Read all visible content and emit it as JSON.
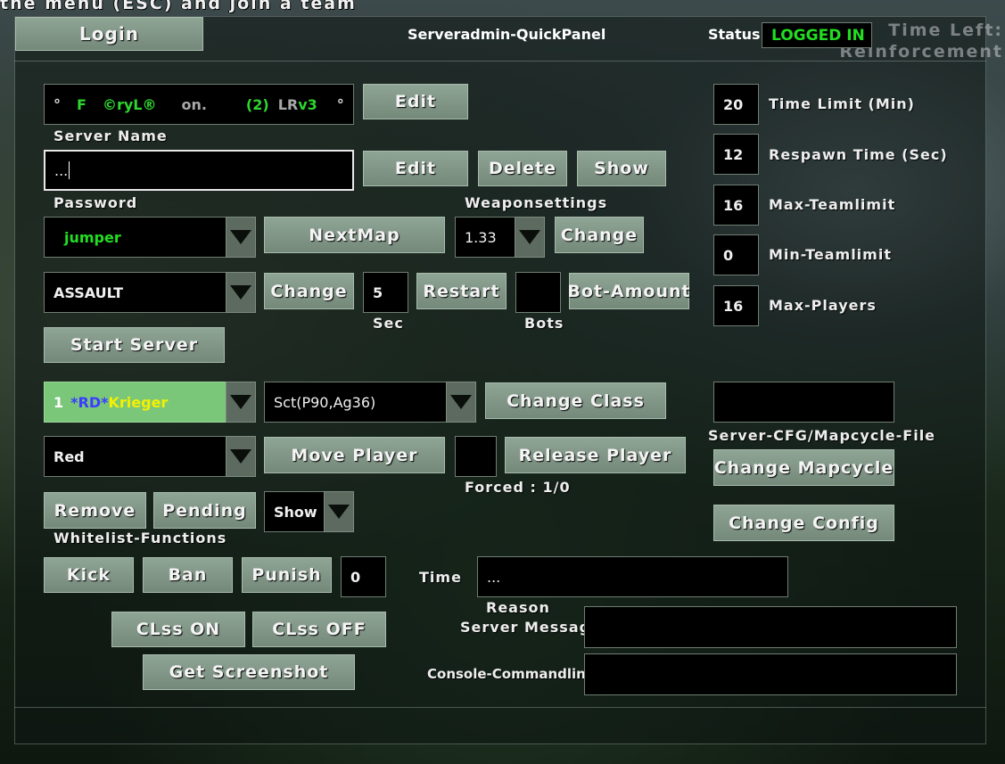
{
  "hud": {
    "top_message": "the menu (ESC) and join a team",
    "time_left": "Time Left:",
    "reinforcement": "Reinforcement"
  },
  "header": {
    "login_label": "Login",
    "title": "Serveradmin-QuickPanel",
    "status_label": "Status:",
    "status_value": "LOGGED IN"
  },
  "server": {
    "name_parts": [
      "°",
      "F",
      "©ryL®",
      "on.",
      "(2)",
      "LR",
      "v3",
      "°"
    ],
    "name_edit": "Edit",
    "name_label": "Server Name",
    "password_value": "...",
    "password_edit": "Edit",
    "password_delete": "Delete",
    "password_show": "Show",
    "password_label": "Password",
    "weapon_label": "Weaponsettings",
    "map_value": "jumper",
    "nextmap": "NextMap",
    "weapon_value": "1.33",
    "weapon_change": "Change",
    "mode_value": "ASSAULT",
    "mode_change": "Change",
    "restart_seconds": "5",
    "restart": "Restart",
    "bots_value": "",
    "bot_amount": "Bot-Amount",
    "sec_label": "Sec",
    "bots_label": "Bots",
    "start_server": "Start Server"
  },
  "settings": [
    {
      "value": "20",
      "label": "Time Limit (Min)"
    },
    {
      "value": "12",
      "label": "Respawn Time (Sec)"
    },
    {
      "value": "16",
      "label": "Max-Teamlimit"
    },
    {
      "value": "0",
      "label": "Min-Teamlimit"
    },
    {
      "value": "16",
      "label": "Max-Players"
    }
  ],
  "player": {
    "num": "1",
    "tag": "*RD*",
    "name": "Krieger",
    "class_value": "Sct(P90,Ag36)",
    "change_class": "Change Class",
    "team_value": "Red",
    "move_player": "Move Player",
    "release_value": "",
    "release_player": "Release Player",
    "forced_label": "Forced : 1/0",
    "remove": "Remove",
    "pending": "Pending",
    "show_value": "Show",
    "whitelist_label": "Whitelist-Functions",
    "kick": "Kick",
    "ban": "Ban",
    "punish": "Punish",
    "time_value": "0",
    "time_label": "Time",
    "reason_value": "...",
    "reason_label": "Reason",
    "clss_on": "CLss ON",
    "clss_off": "CLss OFF",
    "get_screenshot": "Get Screenshot"
  },
  "files": {
    "cfg_value": "",
    "cfg_label": "Server-CFG/Mapcycle-File",
    "change_mapcycle": "Change Mapcycle",
    "change_config": "Change Config"
  },
  "messages": {
    "server_message_label": "Server Message:",
    "server_message_value": "",
    "console_label": "Console-Commandline:",
    "console_value": ""
  },
  "colors": {
    "accent_green": "#22dd22",
    "name_green": "#2fd52f",
    "tag_blue": "#3a3cff",
    "name_yellow": "#f4f000",
    "button": "#7f9585",
    "player_selected": "#7bc77a"
  }
}
